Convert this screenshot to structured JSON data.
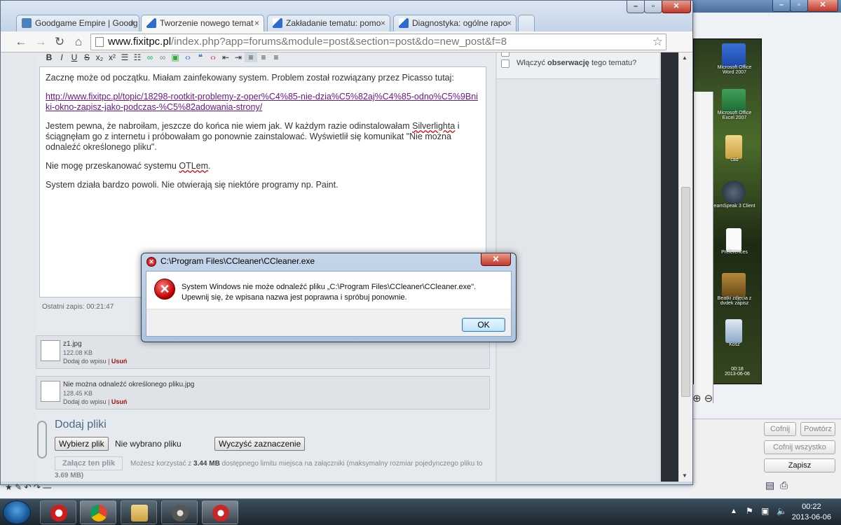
{
  "browser": {
    "tabs": [
      {
        "title": "Goodgame Empire | Goodg",
        "favicon_color": "#4a7fc0"
      },
      {
        "title": "Tworzenie nowego temat",
        "favicon_color": "#2d6bd1",
        "active": true
      },
      {
        "title": "Zakładanie tematu: pomo",
        "favicon_color": "#2d6bd1"
      },
      {
        "title": "Diagnostyka: ogólne rapo",
        "favicon_color": "#2d6bd1"
      }
    ],
    "url_host": "www.fixitpc.pl",
    "url_path": "/index.php?app=forums&module=post&section=post&do=new_post&f=8"
  },
  "editor": {
    "para1": "Zacznę może od początku. Miałam zainfekowany system. Problem został rozwiązany przez Picasso tutaj:",
    "link": "http://www.fixitpc.pl/topic/18298-rootkit-problemy-z-oper%C4%85-nie-dzia%C5%82aj%C4%85-odno%C5%9Bniki-okno-zapisz-jako-podczas-%C5%82adowania-strony/",
    "para3a": "Jestem pewna, że nabroiłam, jeszcze do końca nie wiem jak. W każdym razie odinstalowałam ",
    "para3w": "Silverlighta",
    "para3b": " i ściągnęłam go z internetu i próbowałam go ponownie zainstalować. Wyświetlił się komunikat \"Nie można odnaleźć określonego pliku\".",
    "para4a": "Nie mogę przeskanować systemu ",
    "para4w": "OTLem",
    "para4b": ".",
    "para5": "System działa bardzo powoli. Nie otwierają się niektóre programy np. Paint.",
    "last_save": "Ostatni zapis: 00:21:47"
  },
  "attachments": [
    {
      "name": "z1.jpg",
      "size": "122.08 KB",
      "add": "Dodaj do wpisu",
      "sep": "|",
      "remove": "Usuń"
    },
    {
      "name": "Nie można odnaleźć określonego pliku.jpg",
      "size": "128.45 KB",
      "add": "Dodaj do wpisu",
      "sep": "|",
      "remove": "Usuń"
    }
  ],
  "upload": {
    "title": "Dodaj pliki",
    "choose": "Wybierz plik",
    "no_file": "Nie wybrano pliku",
    "clear": "Wyczyść zaznaczenie",
    "attach": "Załącz ten plik",
    "limit_pre": "Możesz korzystać z ",
    "limit_val": "3.44 MB",
    "limit_post": " dostępnego limitu miejsca na załączniki (maksymalny rozmiar pojedynczego pliku to",
    "limit_max": "3.69 MB)"
  },
  "side": {
    "watch_pre": "Włączyć ",
    "watch_bold": "obserwację",
    "watch_post": " tego tematu?"
  },
  "dialog": {
    "title": "C:\\Program Files\\CCleaner\\CCleaner.exe",
    "line1": "System Windows nie może odnaleźć pliku „C:\\Program Files\\CCleaner\\CCleaner.exe\".",
    "line2": "Upewnij się, że wpisana nazwa jest poprawna i spróbuj ponownie.",
    "ok": "OK"
  },
  "background_app": {
    "buttons": [
      "Cofnij",
      "Powtórz",
      "Cofnij wszystko",
      "Zapisz"
    ],
    "desktop_icons": [
      "Microsoft Office Word 2007",
      "Microsoft Office Excel 2007",
      "cad",
      "eamSpeak 3 Client",
      "Preferences",
      "Beatki zdjęcia z dvdek zapisz",
      "Kosz"
    ],
    "photo_clock_time": "00:18",
    "photo_clock_date": "2013-06-06"
  },
  "taskbar": {
    "time": "00:22",
    "date": "2013-06-06"
  },
  "colors": {
    "error_red": "#c10000",
    "link": "#6a1a8a",
    "remove_red": "#a01010"
  }
}
